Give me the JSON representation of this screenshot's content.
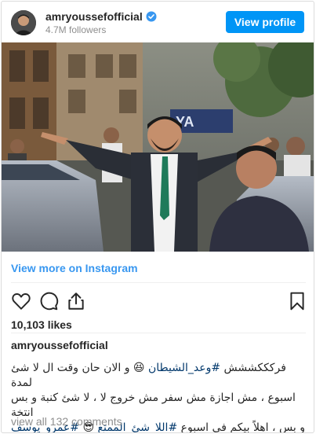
{
  "header": {
    "username": "amryoussefofficial",
    "followers": "4.7M followers",
    "view_profile_label": "View profile"
  },
  "view_more_label": "View more on Instagram",
  "likes": "10,103 likes",
  "caption": {
    "username": "amryoussefofficial",
    "line1_a": "فركككششش ",
    "line1_tag": "#وعد_الشيطان",
    "line1_b": " 😆 و الان حان وقت ال لا شئ لمدة",
    "line2": "اسبوع ، مش اجازة مش سفر مش خروج لا ، لا شئ كنبة و بس انتخة",
    "line3_a": "و بس ، اهلاً بيكم في اسبوع ",
    "line3_tag1": "#اللا_شئ_الممتع",
    "line3_b": " 😎 ",
    "line3_tag2": "#عمرو_يوسف"
  },
  "comments_label": "view all 132 comments",
  "icons": {
    "verified": "verified-badge-icon",
    "like": "heart-icon",
    "comment": "comment-icon",
    "share": "share-icon",
    "save": "bookmark-icon"
  },
  "colors": {
    "accent": "#0095f6",
    "link": "#3897f0",
    "hashtag": "#00376b",
    "secondary_text": "#8e8e8e"
  }
}
